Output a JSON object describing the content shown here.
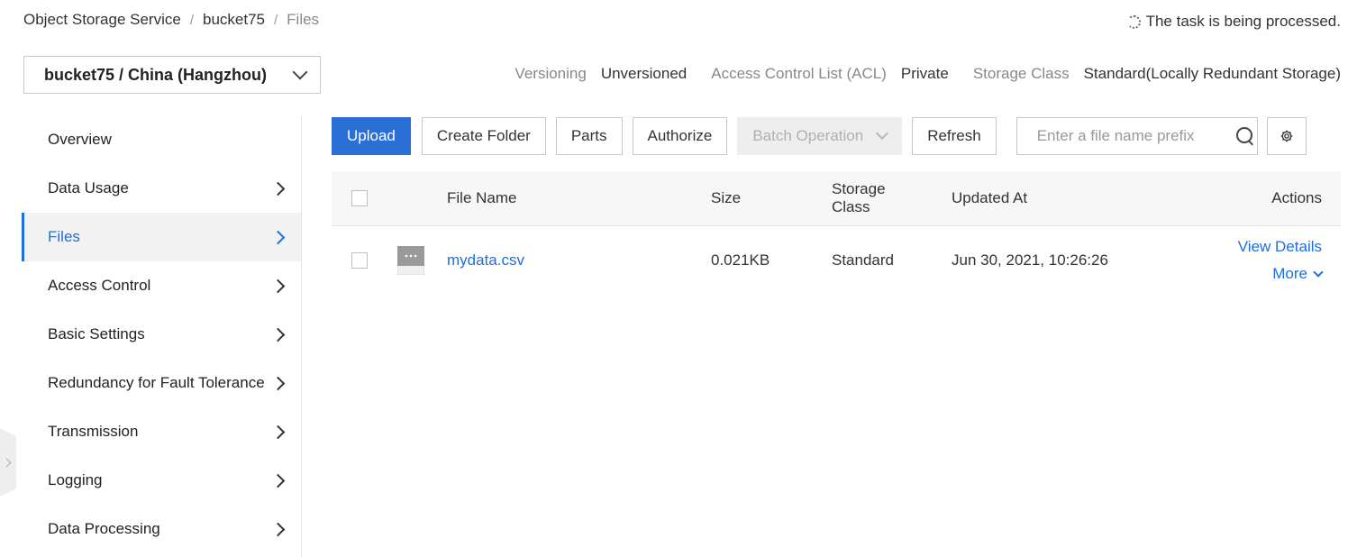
{
  "breadcrumb": {
    "items": [
      "Object Storage Service",
      "bucket75",
      "Files"
    ],
    "separator": "/"
  },
  "task_status": "The task is being processed.",
  "bucket_selector": {
    "value": "bucket75 / China (Hangzhou)"
  },
  "meta": {
    "versioning_label": "Versioning",
    "versioning_value": "Unversioned",
    "acl_label": "Access Control List (ACL)",
    "acl_value": "Private",
    "storage_class_label": "Storage Class",
    "storage_class_value": "Standard(Locally Redundant Storage)"
  },
  "sidebar": {
    "items": [
      {
        "label": "Overview",
        "has_children": false,
        "active": false
      },
      {
        "label": "Data Usage",
        "has_children": true,
        "active": false
      },
      {
        "label": "Files",
        "has_children": true,
        "active": true
      },
      {
        "label": "Access Control",
        "has_children": true,
        "active": false
      },
      {
        "label": "Basic Settings",
        "has_children": true,
        "active": false
      },
      {
        "label": "Redundancy for Fault Tolerance",
        "has_children": true,
        "active": false
      },
      {
        "label": "Transmission",
        "has_children": true,
        "active": false
      },
      {
        "label": "Logging",
        "has_children": true,
        "active": false
      },
      {
        "label": "Data Processing",
        "has_children": true,
        "active": false
      }
    ]
  },
  "toolbar": {
    "upload": "Upload",
    "create_folder": "Create Folder",
    "parts": "Parts",
    "authorize": "Authorize",
    "batch_operation": "Batch Operation",
    "refresh": "Refresh",
    "search_placeholder": "Enter a file name prefix"
  },
  "table": {
    "headers": {
      "file_name": "File Name",
      "size": "Size",
      "storage_class": "Storage Class",
      "updated_at": "Updated At",
      "actions": "Actions"
    },
    "rows": [
      {
        "file_name": "mydata.csv",
        "size": "0.021KB",
        "storage_class": "Standard",
        "updated_at": "Jun 30, 2021, 10:26:26",
        "view_details": "View Details",
        "more": "More"
      }
    ]
  },
  "colors": {
    "primary": "#2a6fd6",
    "link": "#1e6fdc",
    "muted_text": "#888888",
    "border": "#c8c8c8"
  },
  "icons": {
    "task_status": "spinner-icon",
    "bucket_selector": "chevron-down-icon",
    "sidebar_item": "chevron-right-icon",
    "search": "search-icon",
    "settings": "gear-icon",
    "file": "file-icon"
  }
}
